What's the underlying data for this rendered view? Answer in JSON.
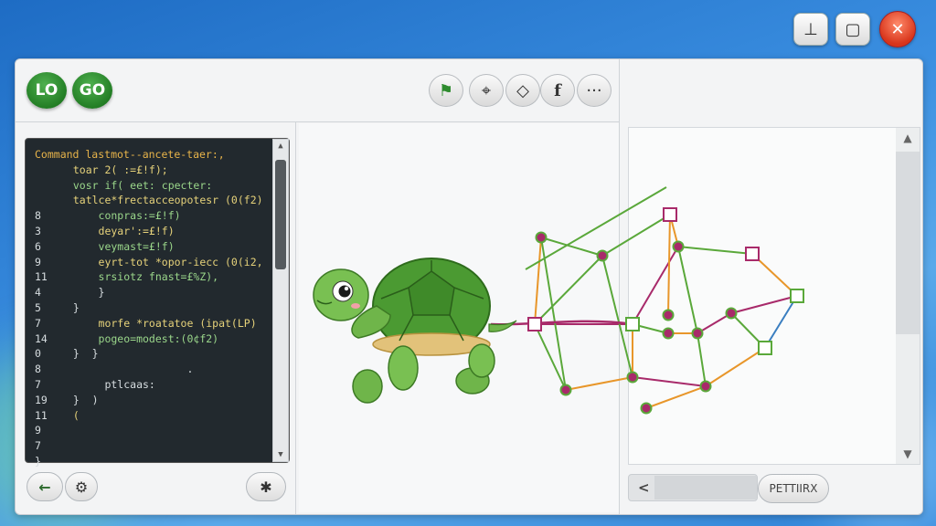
{
  "titlebar": {
    "minimize_glyph": "⊥",
    "maximize_glyph": "▢",
    "close_glyph": "✕"
  },
  "toolbar": {
    "logo_labels": [
      "LO",
      "GO"
    ],
    "buttons": [
      {
        "name": "flag",
        "glyph": "⚑"
      },
      {
        "name": "shape",
        "glyph": "⌖"
      },
      {
        "name": "diamond",
        "glyph": "◇"
      },
      {
        "name": "function",
        "glyph": "f"
      },
      {
        "name": "more",
        "glyph": "···"
      }
    ]
  },
  "editor": {
    "lines": [
      {
        "n": "",
        "text": "Command lastmot--ancete-taer:,"
      },
      {
        "n": "",
        "text": "  toar 2( :=£!f);"
      },
      {
        "n": "",
        "text": "  vosr if( eet: cpecter:"
      },
      {
        "n": "",
        "text": "  tatlce*frectacceopotesr (0(f2)"
      },
      {
        "n": "8",
        "text": "      conpras:=£!f)"
      },
      {
        "n": "3",
        "text": "      deyar':=£!f)"
      },
      {
        "n": "6",
        "text": "      veymast=£!f)"
      },
      {
        "n": "9",
        "text": "      eyrt-tot *opor-iecc (0(i2,"
      },
      {
        "n": "11",
        "text": "      srsiotz fnast=£%Z),"
      },
      {
        "n": "4",
        "text": "      }"
      },
      {
        "n": "5",
        "text": "  }"
      },
      {
        "n": "7",
        "text": "      morfe *roatatoe (ipat(LP)"
      },
      {
        "n": "14",
        "text": "      pogeo=modest:(0¢f2)"
      },
      {
        "n": "0",
        "text": "  }  }"
      },
      {
        "n": "8",
        "text": "                    ."
      },
      {
        "n": "7",
        "text": "       ptlcaas:"
      },
      {
        "n": "19",
        "text": "  }  )"
      },
      {
        "n": "11",
        "text": "  ("
      },
      {
        "n": "9",
        "text": ""
      },
      {
        "n": "7",
        "text": ""
      },
      {
        "n": "}",
        "text": ""
      }
    ]
  },
  "editor_controls": {
    "back_glyph": "←",
    "settings_glyph": "⚙",
    "star_glyph": "✱"
  },
  "right_panel": {
    "button_label": "PETTIIRX",
    "left_arrow": "<"
  },
  "colors": {
    "accent": "#2e8b2e",
    "window_frame": "#2b7fd6",
    "close": "#d8351b",
    "line_green": "#5aa83a",
    "line_orange": "#e8962a",
    "line_magenta": "#a82a6a",
    "line_blue": "#3a7ec0"
  }
}
